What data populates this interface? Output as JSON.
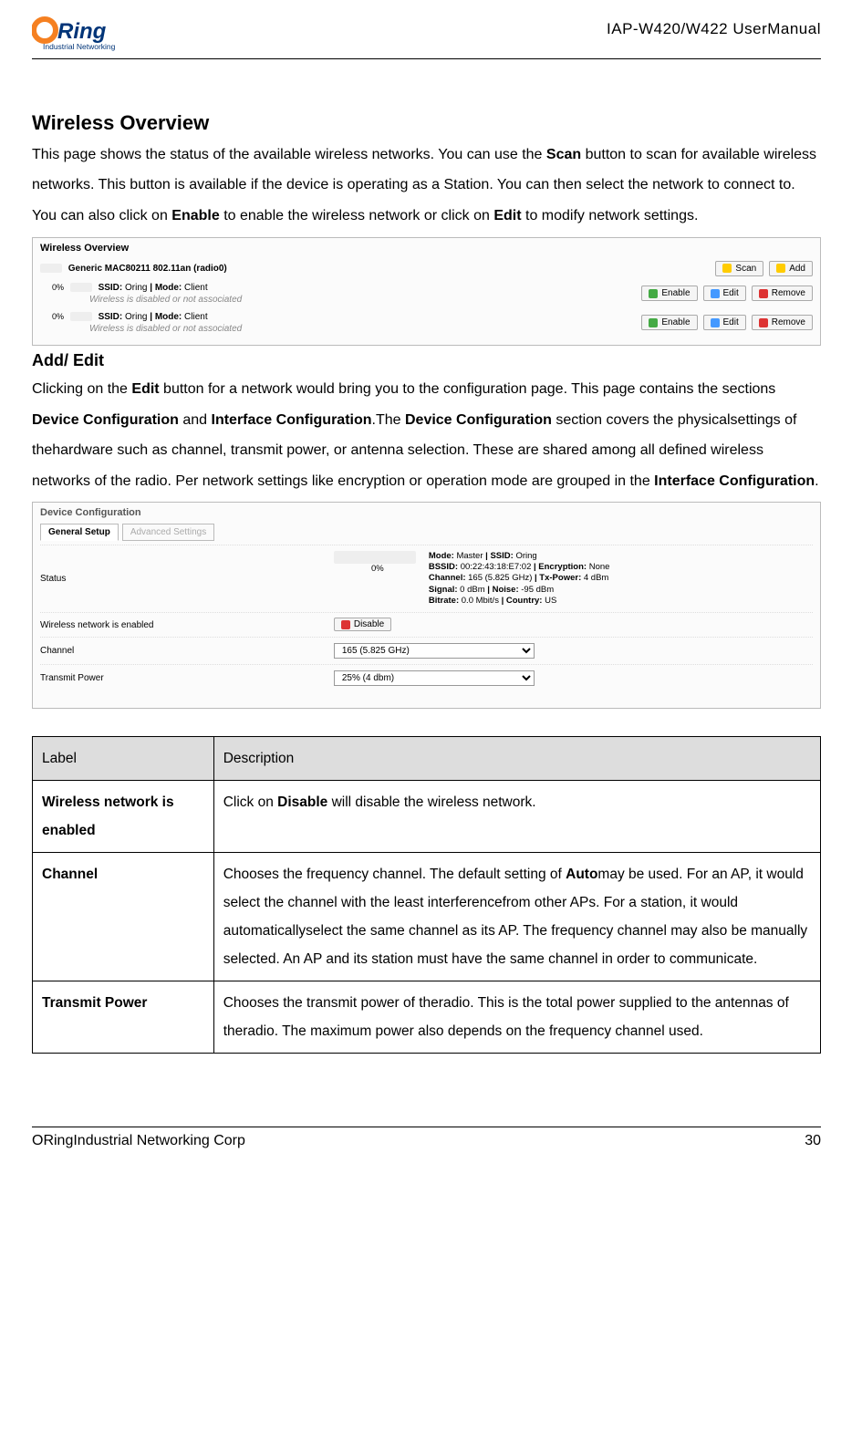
{
  "header": {
    "logo_path1_fill": "#f58021",
    "logo_path2_fill": "#003478",
    "logo_sub": "Industrial Networking",
    "doc_title": "IAP-W420/W422  UserManual"
  },
  "footer": {
    "left": "ORingIndustrial Networking Corp",
    "right": "30"
  },
  "h2_overview": "Wireless Overview",
  "p_overview_1a": "This page shows the status of the available wireless networks. You can use the ",
  "p_overview_1b": "Scan",
  "p_overview_1c": " button to scan for available wireless networks. This button is available if the device is operating as a Station. You can then select the network to connect to. You can also click on ",
  "p_overview_1d": "Enable",
  "p_overview_1e": " to enable the wireless network or click on ",
  "p_overview_1f": "Edit",
  "p_overview_1g": " to modify network settings.",
  "panel_ov": {
    "title": "Wireless Overview",
    "radio": "Generic MAC80211 802.11an (radio0)",
    "scan": "Scan",
    "add": "Add",
    "ssid_prefix": "SSID: ",
    "ssid_val": "Oring",
    "mode_prefix": " | Mode: ",
    "mode_val": "Client",
    "note": "Wireless is disabled or not associated",
    "pct": "0%",
    "enable": "Enable",
    "edit": "Edit",
    "remove": "Remove"
  },
  "h3_addedit": "Add/ Edit",
  "p_addedit_1a": "Clicking on the ",
  "p_addedit_1b": "Edit",
  "p_addedit_1c": " button for a network would bring you to the configuration page. This page contains the sections ",
  "p_addedit_1d": "Device Configuration",
  "p_addedit_1e": " and ",
  "p_addedit_1f": "Interface Configuration",
  "p_addedit_1g": ".The ",
  "p_addedit_1h": "Device Configuration",
  "p_addedit_1i": " section covers the physicalsettings of thehardware such as channel, transmit power, or antenna selection. These are shared among all defined wireless networks of the radio. Per network settings like encryption or operation mode are grouped in the ",
  "p_addedit_1j": "Interface Configuration",
  "p_addedit_1k": ".",
  "panel_cfg": {
    "title": "Device Configuration",
    "tab1": "General Setup",
    "tab2": "Advanced Settings",
    "lbl_status": "Status",
    "stat_pct": "0%",
    "stat_l1a": "Mode: ",
    "stat_l1b": "Master",
    "stat_l1c": " | SSID: ",
    "stat_l1d": "Oring",
    "stat_l2a": "BSSID: ",
    "stat_l2b": "00:22:43:18:E7:02",
    "stat_l2c": " | Encryption: ",
    "stat_l2d": "None",
    "stat_l3a": "Channel: ",
    "stat_l3b": "165 (5.825 GHz)",
    "stat_l3c": " | Tx-Power: ",
    "stat_l3d": "4 dBm",
    "stat_l4a": "Signal: ",
    "stat_l4b": "0 dBm",
    "stat_l4c": " | Noise: ",
    "stat_l4d": "-95 dBm",
    "stat_l5a": "Bitrate: ",
    "stat_l5b": "0.0 Mbit/s",
    "stat_l5c": " | Country: ",
    "stat_l5d": "US",
    "lbl_enabled": "Wireless network is enabled",
    "btn_disable": "Disable",
    "lbl_channel": "Channel",
    "val_channel": "165 (5.825 GHz)",
    "lbl_tx": "Transmit Power",
    "val_tx": "25% (4 dbm)"
  },
  "table": {
    "h_label": "Label",
    "h_desc": "Description",
    "r1_label": "Wireless network is enabled",
    "r1_desc_a": "Click on ",
    "r1_desc_b": "Disable",
    "r1_desc_c": " will disable the wireless network.",
    "r2_label": "Channel",
    "r2_desc_a": "Chooses the frequency channel. The default setting of ",
    "r2_desc_b": "Auto",
    "r2_desc_c": "may be used. For an AP, it would select the channel with the least interferencefrom other APs. For a station, it would automaticallyselect the same channel as its AP. The frequency channel may also be manually selected. An AP and its station must have the same channel in order to communicate.",
    "r3_label": "Transmit Power",
    "r3_desc": "Chooses the transmit power of theradio. This is the total power supplied to the antennas of theradio. The maximum power also depends on the frequency channel used."
  }
}
